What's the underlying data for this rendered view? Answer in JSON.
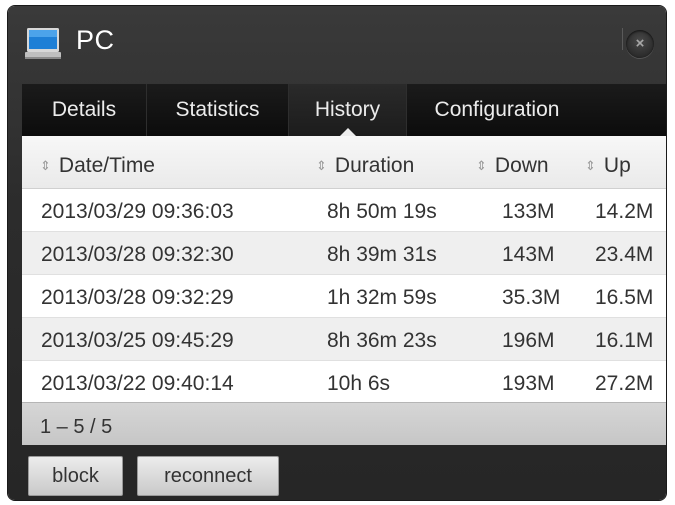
{
  "window": {
    "title": "PC",
    "close_symbol": "×",
    "title_icon": "monitor-icon"
  },
  "tabs": [
    {
      "label": "Details",
      "active": false
    },
    {
      "label": "Statistics",
      "active": false
    },
    {
      "label": "History",
      "active": true
    },
    {
      "label": "Configuration",
      "active": false
    }
  ],
  "table": {
    "sort_symbol": "⇕",
    "columns": [
      "Date/Time",
      "Duration",
      "Down",
      "Up"
    ],
    "rows": [
      [
        "2013/03/29 09:36:03",
        "8h 50m 19s",
        "133M",
        "14.2M"
      ],
      [
        "2013/03/28 09:32:30",
        "8h 39m 31s",
        "143M",
        "23.4M"
      ],
      [
        "2013/03/28 09:32:29",
        "1h 32m 59s",
        "35.3M",
        "16.5M"
      ],
      [
        "2013/03/25 09:45:29",
        "8h 36m 23s",
        "196M",
        "16.1M"
      ],
      [
        "2013/03/22 09:40:14",
        "10h 6s",
        "193M",
        "27.2M"
      ]
    ]
  },
  "pager": {
    "text": "1 – 5 / 5"
  },
  "buttons": {
    "block": "block",
    "reconnect": "reconnect"
  },
  "colors": {
    "window_bg": "#2c2c2c",
    "tab_bar_bg": "#111111",
    "row_alt_bg": "#efefef",
    "footer_bg": "#cccccc"
  }
}
